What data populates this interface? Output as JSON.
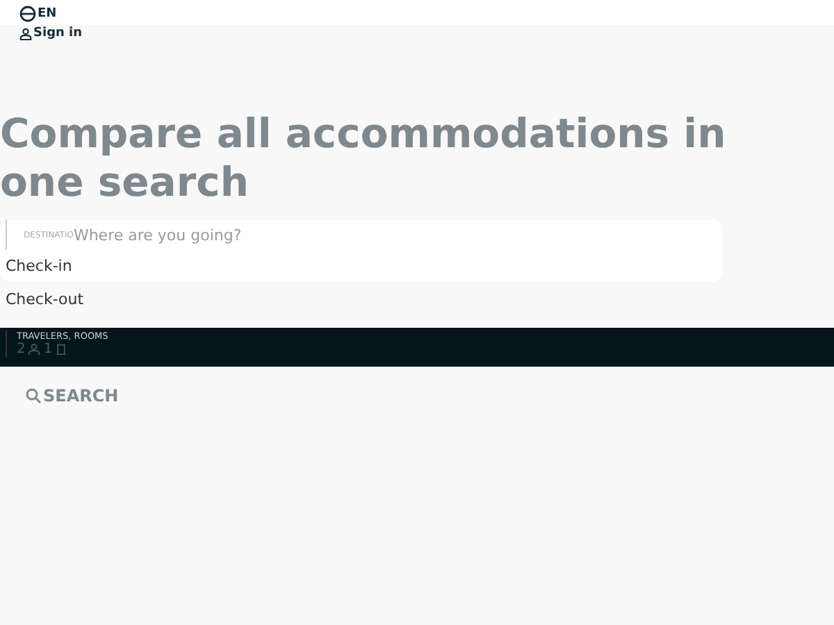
{
  "header": {
    "language": "EN",
    "sign_in": "Sign in"
  },
  "hero": {
    "title": "Compare all accommodations in one search"
  },
  "search": {
    "destination_label": "DESTINATIO",
    "destination_placeholder": "Where are you going?",
    "check_in": "Check-in",
    "check_out": "Check-out",
    "travelers_label": "TRAVELERS, ROOMS",
    "travelers": "2",
    "rooms": "1",
    "button": "SEARCH"
  }
}
